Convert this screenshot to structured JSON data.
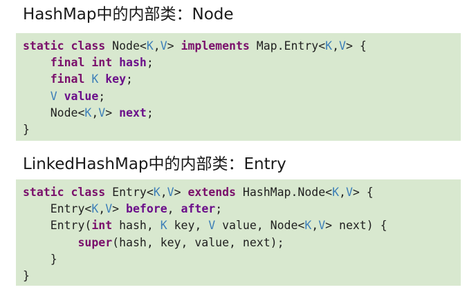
{
  "headings": {
    "first": "HashMap中的内部类：Node",
    "second": "LinkedHashMap中的内部类：Entry"
  },
  "code_blocks": [
    {
      "lines": [
        [
          [
            "kw",
            "static"
          ],
          [
            "t",
            " "
          ],
          [
            "kw",
            "class"
          ],
          [
            "t",
            " Node<"
          ],
          [
            "tp",
            "K"
          ],
          [
            "t",
            ","
          ],
          [
            "tp",
            "V"
          ],
          [
            "t",
            "> "
          ],
          [
            "kw",
            "implements"
          ],
          [
            "t",
            " Map.Entry<"
          ],
          [
            "tp",
            "K"
          ],
          [
            "t",
            ","
          ],
          [
            "tp",
            "V"
          ],
          [
            "t",
            "> {"
          ]
        ],
        [
          [
            "t",
            "    "
          ],
          [
            "kw",
            "final"
          ],
          [
            "t",
            " "
          ],
          [
            "kw",
            "int"
          ],
          [
            "t",
            " "
          ],
          [
            "fdb",
            "hash"
          ],
          [
            "t",
            ";"
          ]
        ],
        [
          [
            "t",
            "    "
          ],
          [
            "kw",
            "final"
          ],
          [
            "t",
            " "
          ],
          [
            "tp",
            "K"
          ],
          [
            "t",
            " "
          ],
          [
            "fdb",
            "key"
          ],
          [
            "t",
            ";"
          ]
        ],
        [
          [
            "t",
            "    "
          ],
          [
            "tp",
            "V"
          ],
          [
            "t",
            " "
          ],
          [
            "fdb",
            "value"
          ],
          [
            "t",
            ";"
          ]
        ],
        [
          [
            "t",
            "    Node<"
          ],
          [
            "tp",
            "K"
          ],
          [
            "t",
            ","
          ],
          [
            "tp",
            "V"
          ],
          [
            "t",
            "> "
          ],
          [
            "fdb",
            "next"
          ],
          [
            "t",
            ";"
          ]
        ],
        [
          [
            "t",
            "}"
          ]
        ]
      ]
    },
    {
      "lines": [
        [
          [
            "kw",
            "static"
          ],
          [
            "t",
            " "
          ],
          [
            "kw",
            "class"
          ],
          [
            "t",
            " Entry<"
          ],
          [
            "tp",
            "K"
          ],
          [
            "t",
            ","
          ],
          [
            "tp",
            "V"
          ],
          [
            "t",
            "> "
          ],
          [
            "kw",
            "extends"
          ],
          [
            "t",
            " HashMap.Node<"
          ],
          [
            "tp",
            "K"
          ],
          [
            "t",
            ","
          ],
          [
            "tp",
            "V"
          ],
          [
            "t",
            "> {"
          ]
        ],
        [
          [
            "t",
            "    Entry<"
          ],
          [
            "tp",
            "K"
          ],
          [
            "t",
            ","
          ],
          [
            "tp",
            "V"
          ],
          [
            "t",
            "> "
          ],
          [
            "fdb",
            "before"
          ],
          [
            "t",
            ", "
          ],
          [
            "fdb",
            "after"
          ],
          [
            "t",
            ";"
          ]
        ],
        [
          [
            "t",
            "    Entry("
          ],
          [
            "kw",
            "int"
          ],
          [
            "t",
            " hash, "
          ],
          [
            "tp",
            "K"
          ],
          [
            "t",
            " key, "
          ],
          [
            "tp",
            "V"
          ],
          [
            "t",
            " value, Node<"
          ],
          [
            "tp",
            "K"
          ],
          [
            "t",
            ","
          ],
          [
            "tp",
            "V"
          ],
          [
            "t",
            "> next) {"
          ]
        ],
        [
          [
            "t",
            "        "
          ],
          [
            "kw",
            "super"
          ],
          [
            "t",
            "(hash, key, value, next);"
          ]
        ],
        [
          [
            "t",
            "    }"
          ]
        ],
        [
          [
            "t",
            "}"
          ]
        ]
      ]
    }
  ]
}
